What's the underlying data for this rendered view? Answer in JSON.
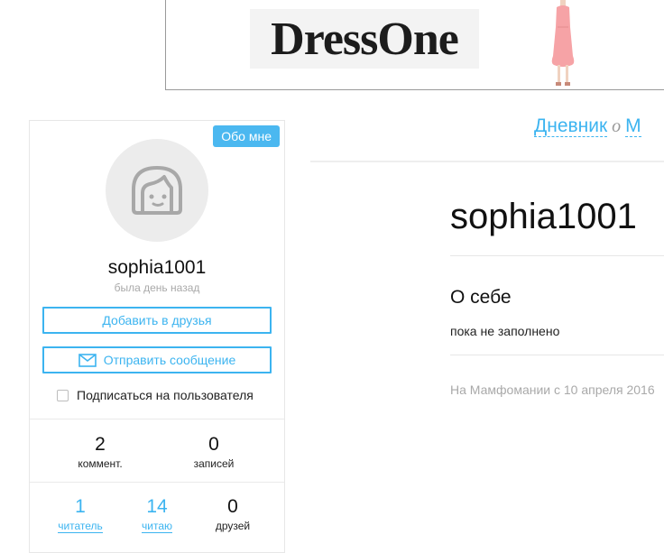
{
  "banner": {
    "brand": "DressOne"
  },
  "profile_card": {
    "about_badge": "Обо мне",
    "username": "sophia1001",
    "last_seen": "была день назад",
    "add_friend_label": "Добавить в друзья",
    "send_message_label": "Отправить сообщение",
    "subscribe_label": "Подписаться на пользователя",
    "stats_top": [
      {
        "value": "2",
        "label": "коммент."
      },
      {
        "value": "0",
        "label": "записей"
      }
    ],
    "stats_bottom": [
      {
        "value": "1",
        "label": "читатель"
      },
      {
        "value": "14",
        "label": "читаю"
      },
      {
        "value": "0",
        "label": "друзей"
      }
    ]
  },
  "tabs": {
    "diary": "Дневник",
    "separator": "o",
    "next": "М"
  },
  "main": {
    "title": "sophia1001",
    "about_title": "О себе",
    "about_text": "пока не заполнено",
    "member_since": "На Мамфомании с 10 апреля 2016"
  },
  "colors": {
    "accent": "#3cb4f0",
    "badge": "#4bb8f0",
    "muted": "#a9a9a9",
    "dress": "#f6a3a6"
  }
}
